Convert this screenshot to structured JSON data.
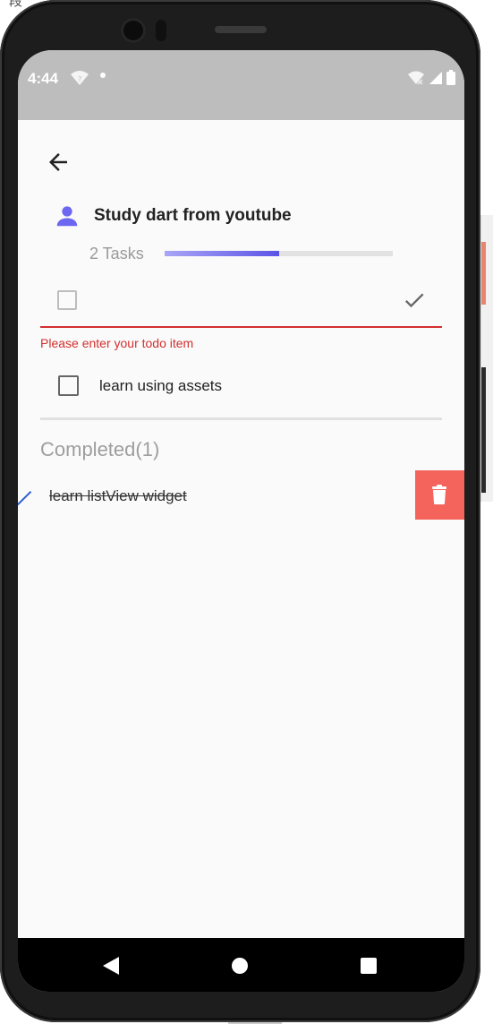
{
  "status_bar": {
    "time": "4:44"
  },
  "project": {
    "title": "Study dart from youtube",
    "tasks_label": "2 Tasks",
    "progress": 0.5
  },
  "new_todo": {
    "error": "Please enter your todo item"
  },
  "todos": [
    {
      "label": "learn using assets",
      "done": false
    }
  ],
  "completed": {
    "header": "Completed(1)",
    "items": [
      {
        "label": "learn listView widget"
      }
    ]
  },
  "icons": {
    "back": "arrow-left-icon",
    "person": "person-icon",
    "confirm": "check-icon",
    "delete": "trash-icon",
    "completed_check": "check-icon"
  },
  "colors": {
    "accent": "#5b55e6",
    "error": "#d32f2f",
    "delete": "#f4645c",
    "status_bar": "#bdbdbd"
  }
}
